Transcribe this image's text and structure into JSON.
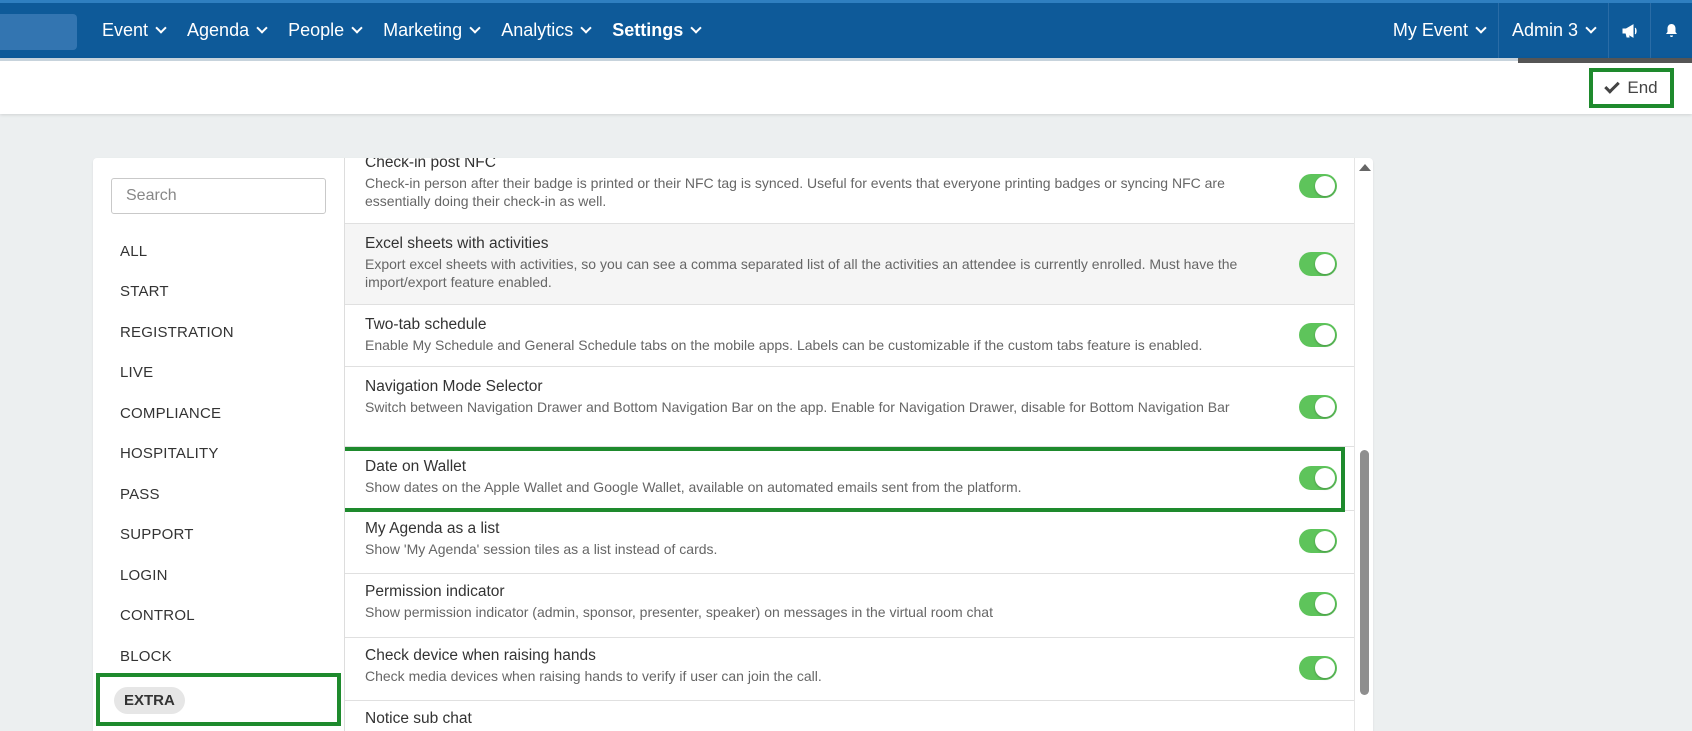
{
  "nav": {
    "items": [
      "Event",
      "Agenda",
      "People",
      "Marketing",
      "Analytics",
      "Settings"
    ],
    "active": "Settings",
    "right": {
      "event": "My Event",
      "admin": "Admin 3",
      "announce_icon": "megaphone-icon",
      "bell_icon": "bell-icon"
    }
  },
  "subbar": {
    "end_label": "End"
  },
  "search": {
    "placeholder": "Search"
  },
  "categories": [
    "ALL",
    "START",
    "REGISTRATION",
    "LIVE",
    "COMPLIANCE",
    "HOSPITALITY",
    "PASS",
    "SUPPORT",
    "LOGIN",
    "CONTROL",
    "BLOCK",
    "EXTRA"
  ],
  "selected_category": "EXTRA",
  "features": [
    {
      "title": "Check-in post NFC",
      "desc": "Check-in person after their badge is printed or their NFC tag is synced. Useful for events that everyone printing badges or syncing NFC are essentially doing their check-in as well.",
      "enabled": true
    },
    {
      "title": "Excel sheets with activities",
      "desc": "Export excel sheets with activities, so you can see a comma separated list of all the activities an attendee is currently enrolled. Must have the import/export feature enabled.",
      "enabled": true
    },
    {
      "title": "Two-tab schedule",
      "desc": "Enable My Schedule and General Schedule tabs on the mobile apps. Labels can be customizable if the custom tabs feature is enabled.",
      "enabled": true
    },
    {
      "title": "Navigation Mode Selector",
      "desc": "Switch between Navigation Drawer and Bottom Navigation Bar on the app. Enable for Navigation Drawer, disable for Bottom Navigation Bar",
      "enabled": true
    },
    {
      "title": "Date on Wallet",
      "desc": "Show dates on the Apple Wallet and Google Wallet, available on automated emails sent from the platform.",
      "enabled": true
    },
    {
      "title": "My Agenda as a list",
      "desc": "Show 'My Agenda' session tiles as a list instead of cards.",
      "enabled": true
    },
    {
      "title": "Permission indicator",
      "desc": "Show permission indicator (admin, sponsor, presenter, speaker) on messages in the virtual room chat",
      "enabled": true
    },
    {
      "title": "Check device when raising hands",
      "desc": "Check media devices when raising hands to verify if user can join the call.",
      "enabled": true
    },
    {
      "title": "Notice sub chat",
      "desc": "",
      "enabled": true
    }
  ],
  "colors": {
    "nav_bg": "#0e5a99",
    "toggle_on": "#5ec45b",
    "highlight": "#1e8a2d"
  }
}
